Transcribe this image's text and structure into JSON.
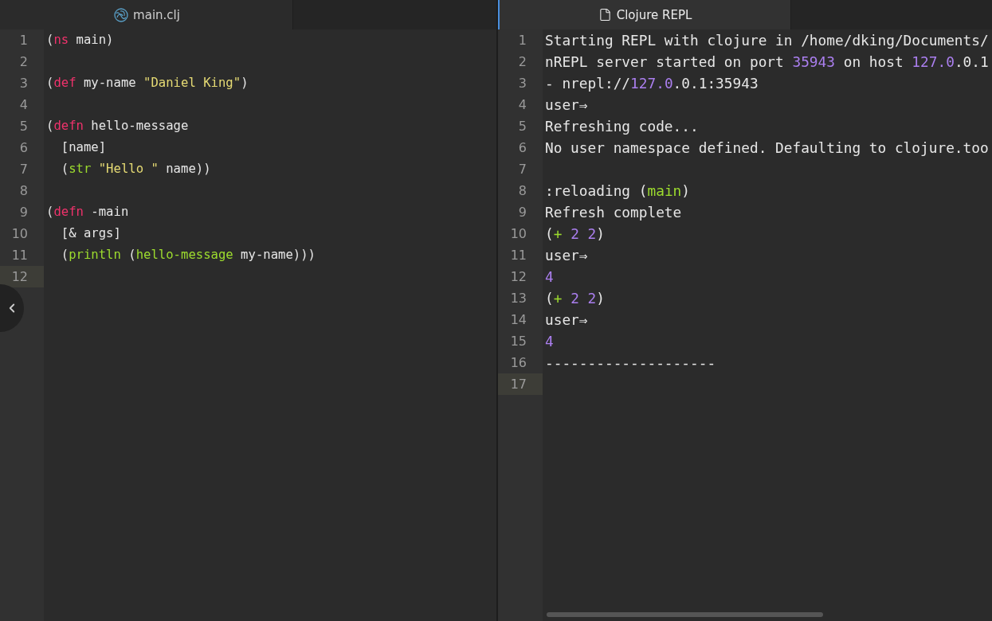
{
  "panes": [
    {
      "focused": false,
      "tab": {
        "label": "main.clj",
        "kind": "clojure"
      },
      "lines": [
        {
          "number": "1",
          "current": false,
          "tokens": [
            {
              "text": "(",
              "kind": "text"
            },
            {
              "text": "ns",
              "kind": "keyword"
            },
            {
              "text": " main)",
              "kind": "text"
            }
          ]
        },
        {
          "number": "2",
          "current": false
        },
        {
          "number": "3",
          "current": false,
          "tokens": [
            {
              "text": "(",
              "kind": "text"
            },
            {
              "text": "def",
              "kind": "keyword"
            },
            {
              "text": " my-name ",
              "kind": "text"
            },
            {
              "text": "\"Daniel King\"",
              "kind": "string"
            },
            {
              "text": ")",
              "kind": "text"
            }
          ]
        },
        {
          "number": "4",
          "current": false
        },
        {
          "number": "5",
          "current": false,
          "tokens": [
            {
              "text": "(",
              "kind": "text"
            },
            {
              "text": "defn",
              "kind": "keyword"
            },
            {
              "text": " hello-message",
              "kind": "text"
            }
          ]
        },
        {
          "number": "6",
          "current": false,
          "tokens": [
            {
              "text": "  [name]",
              "kind": "text"
            }
          ]
        },
        {
          "number": "7",
          "current": false,
          "tokens": [
            {
              "text": "  (",
              "kind": "text"
            },
            {
              "text": "str",
              "kind": "function"
            },
            {
              "text": " \"Hello \"",
              "kind": "string"
            },
            {
              "text": " name))",
              "kind": "text"
            }
          ]
        },
        {
          "number": "8",
          "current": false
        },
        {
          "number": "9",
          "current": false,
          "tokens": [
            {
              "text": "(",
              "kind": "text"
            },
            {
              "text": "defn",
              "kind": "keyword"
            },
            {
              "text": " -main",
              "kind": "text"
            }
          ]
        },
        {
          "number": "10",
          "current": false,
          "tokens": [
            {
              "text": "  [& args]",
              "kind": "text"
            }
          ]
        },
        {
          "number": "11",
          "current": false,
          "tokens": [
            {
              "text": "  (",
              "kind": "text"
            },
            {
              "text": "println",
              "kind": "function"
            },
            {
              "text": " (",
              "kind": "text"
            },
            {
              "text": "hello-message",
              "kind": "function"
            },
            {
              "text": " my-name)))",
              "kind": "text"
            }
          ]
        },
        {
          "number": "12",
          "current": true
        }
      ]
    },
    {
      "focused": true,
      "tab": {
        "label": "Clojure REPL",
        "kind": "file"
      },
      "lines": [
        {
          "number": "1",
          "current": false,
          "tokens": [
            {
              "text": "Starting REPL with clojure in /home/dking/Documents/",
              "kind": "text"
            }
          ]
        },
        {
          "number": "2",
          "current": false,
          "tokens": [
            {
              "text": "nREPL server started on port ",
              "kind": "text"
            },
            {
              "text": "35943",
              "kind": "number"
            },
            {
              "text": " on host ",
              "kind": "text"
            },
            {
              "text": "127.0",
              "kind": "number"
            },
            {
              "text": ".0.1",
              "kind": "text"
            }
          ]
        },
        {
          "number": "3",
          "current": false,
          "tokens": [
            {
              "text": "- nrepl://",
              "kind": "text"
            },
            {
              "text": "127.0",
              "kind": "number"
            },
            {
              "text": ".0.1:35943",
              "kind": "text"
            }
          ]
        },
        {
          "number": "4",
          "current": false,
          "tokens": [
            {
              "text": "user⇒",
              "kind": "text"
            }
          ]
        },
        {
          "number": "5",
          "current": false,
          "tokens": [
            {
              "text": "Refreshing code...",
              "kind": "text"
            }
          ]
        },
        {
          "number": "6",
          "current": false,
          "tokens": [
            {
              "text": "No user namespace defined. Defaulting to clojure.too",
              "kind": "text"
            }
          ]
        },
        {
          "number": "7",
          "current": false
        },
        {
          "number": "8",
          "current": false,
          "tokens": [
            {
              "text": ":reloading (",
              "kind": "text"
            },
            {
              "text": "main",
              "kind": "function"
            },
            {
              "text": ")",
              "kind": "text"
            }
          ]
        },
        {
          "number": "9",
          "current": false,
          "tokens": [
            {
              "text": "Refresh complete",
              "kind": "text"
            }
          ]
        },
        {
          "number": "10",
          "current": false,
          "tokens": [
            {
              "text": "(",
              "kind": "text"
            },
            {
              "text": "+",
              "kind": "function"
            },
            {
              "text": " 2 2",
              "kind": "number"
            },
            {
              "text": ")",
              "kind": "text"
            }
          ]
        },
        {
          "number": "11",
          "current": false,
          "tokens": [
            {
              "text": "user⇒",
              "kind": "text"
            }
          ]
        },
        {
          "number": "12",
          "current": false,
          "tokens": [
            {
              "text": "4",
              "kind": "number"
            }
          ]
        },
        {
          "number": "13",
          "current": false,
          "tokens": [
            {
              "text": "(",
              "kind": "text"
            },
            {
              "text": "+",
              "kind": "function"
            },
            {
              "text": " 2 2",
              "kind": "number"
            },
            {
              "text": ")",
              "kind": "text"
            }
          ]
        },
        {
          "number": "14",
          "current": false,
          "tokens": [
            {
              "text": "user⇒",
              "kind": "text"
            }
          ]
        },
        {
          "number": "15",
          "current": false,
          "tokens": [
            {
              "text": "4",
              "kind": "number"
            }
          ]
        },
        {
          "number": "16",
          "current": false,
          "tokens": [
            {
              "text": "--------------------",
              "kind": "text"
            }
          ]
        },
        {
          "number": "17",
          "current": true
        }
      ]
    }
  ]
}
